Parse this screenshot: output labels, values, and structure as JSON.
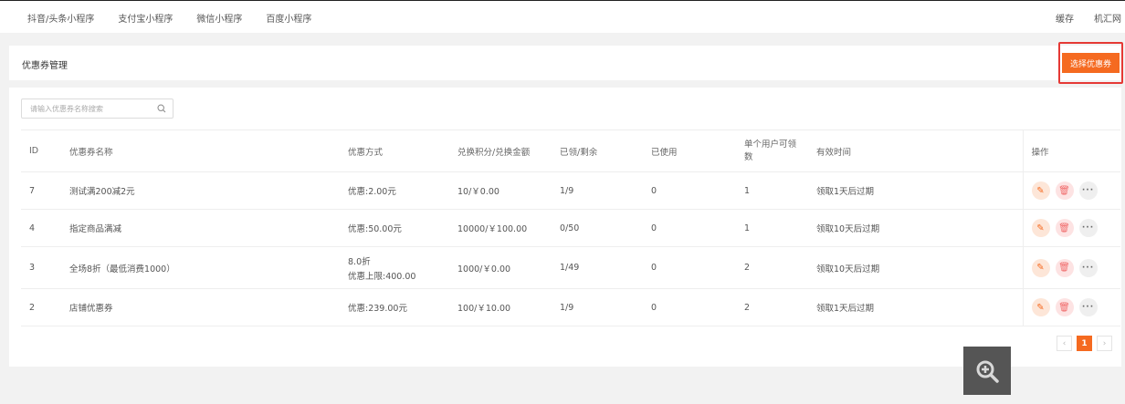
{
  "topbar": {
    "tabs": [
      "抖音/头条小程序",
      "支付宝小程序",
      "微信小程序",
      "百度小程序"
    ],
    "right": [
      "缓存",
      "机汇网"
    ]
  },
  "header": {
    "title": "优惠券管理",
    "select_button": "选择优惠券"
  },
  "search": {
    "placeholder": "请输入优惠券名称搜索"
  },
  "table": {
    "headers": [
      "ID",
      "优惠券名称",
      "优惠方式",
      "兑换积分/兑换金额",
      "已领/剩余",
      "已使用",
      "单个用户可领数",
      "有效时间",
      "操作"
    ],
    "rows": [
      {
        "id": "7",
        "name": "测试满200减2元",
        "discount": "优惠:2.00元",
        "discount2": "",
        "exchange": "10/￥0.00",
        "claimed": "1/9",
        "used": "0",
        "per_user": "1",
        "valid": "领取1天后过期"
      },
      {
        "id": "4",
        "name": "指定商品满减",
        "discount": "优惠:50.00元",
        "discount2": "",
        "exchange": "10000/￥100.00",
        "claimed": "0/50",
        "used": "0",
        "per_user": "1",
        "valid": "领取10天后过期"
      },
      {
        "id": "3",
        "name": "全场8折（最低消费1000）",
        "discount": "8.0折",
        "discount2": "优惠上限:400.00",
        "exchange": "1000/￥0.00",
        "claimed": "1/49",
        "used": "0",
        "per_user": "2",
        "valid": "领取10天后过期"
      },
      {
        "id": "2",
        "name": "店铺优惠券",
        "discount": "优惠:239.00元",
        "discount2": "",
        "exchange": "100/￥10.00",
        "claimed": "1/9",
        "used": "0",
        "per_user": "2",
        "valid": "领取1天后过期"
      }
    ]
  },
  "pagination": {
    "prev": "‹",
    "current": "1",
    "next": "›"
  },
  "icons": {
    "edit": "pencil-icon",
    "delete": "trash-icon",
    "more": "more-icon",
    "search": "search-icon",
    "zoom": "zoom-in-icon"
  },
  "colors": {
    "accent": "#f56a20",
    "highlight": "#e53935"
  }
}
